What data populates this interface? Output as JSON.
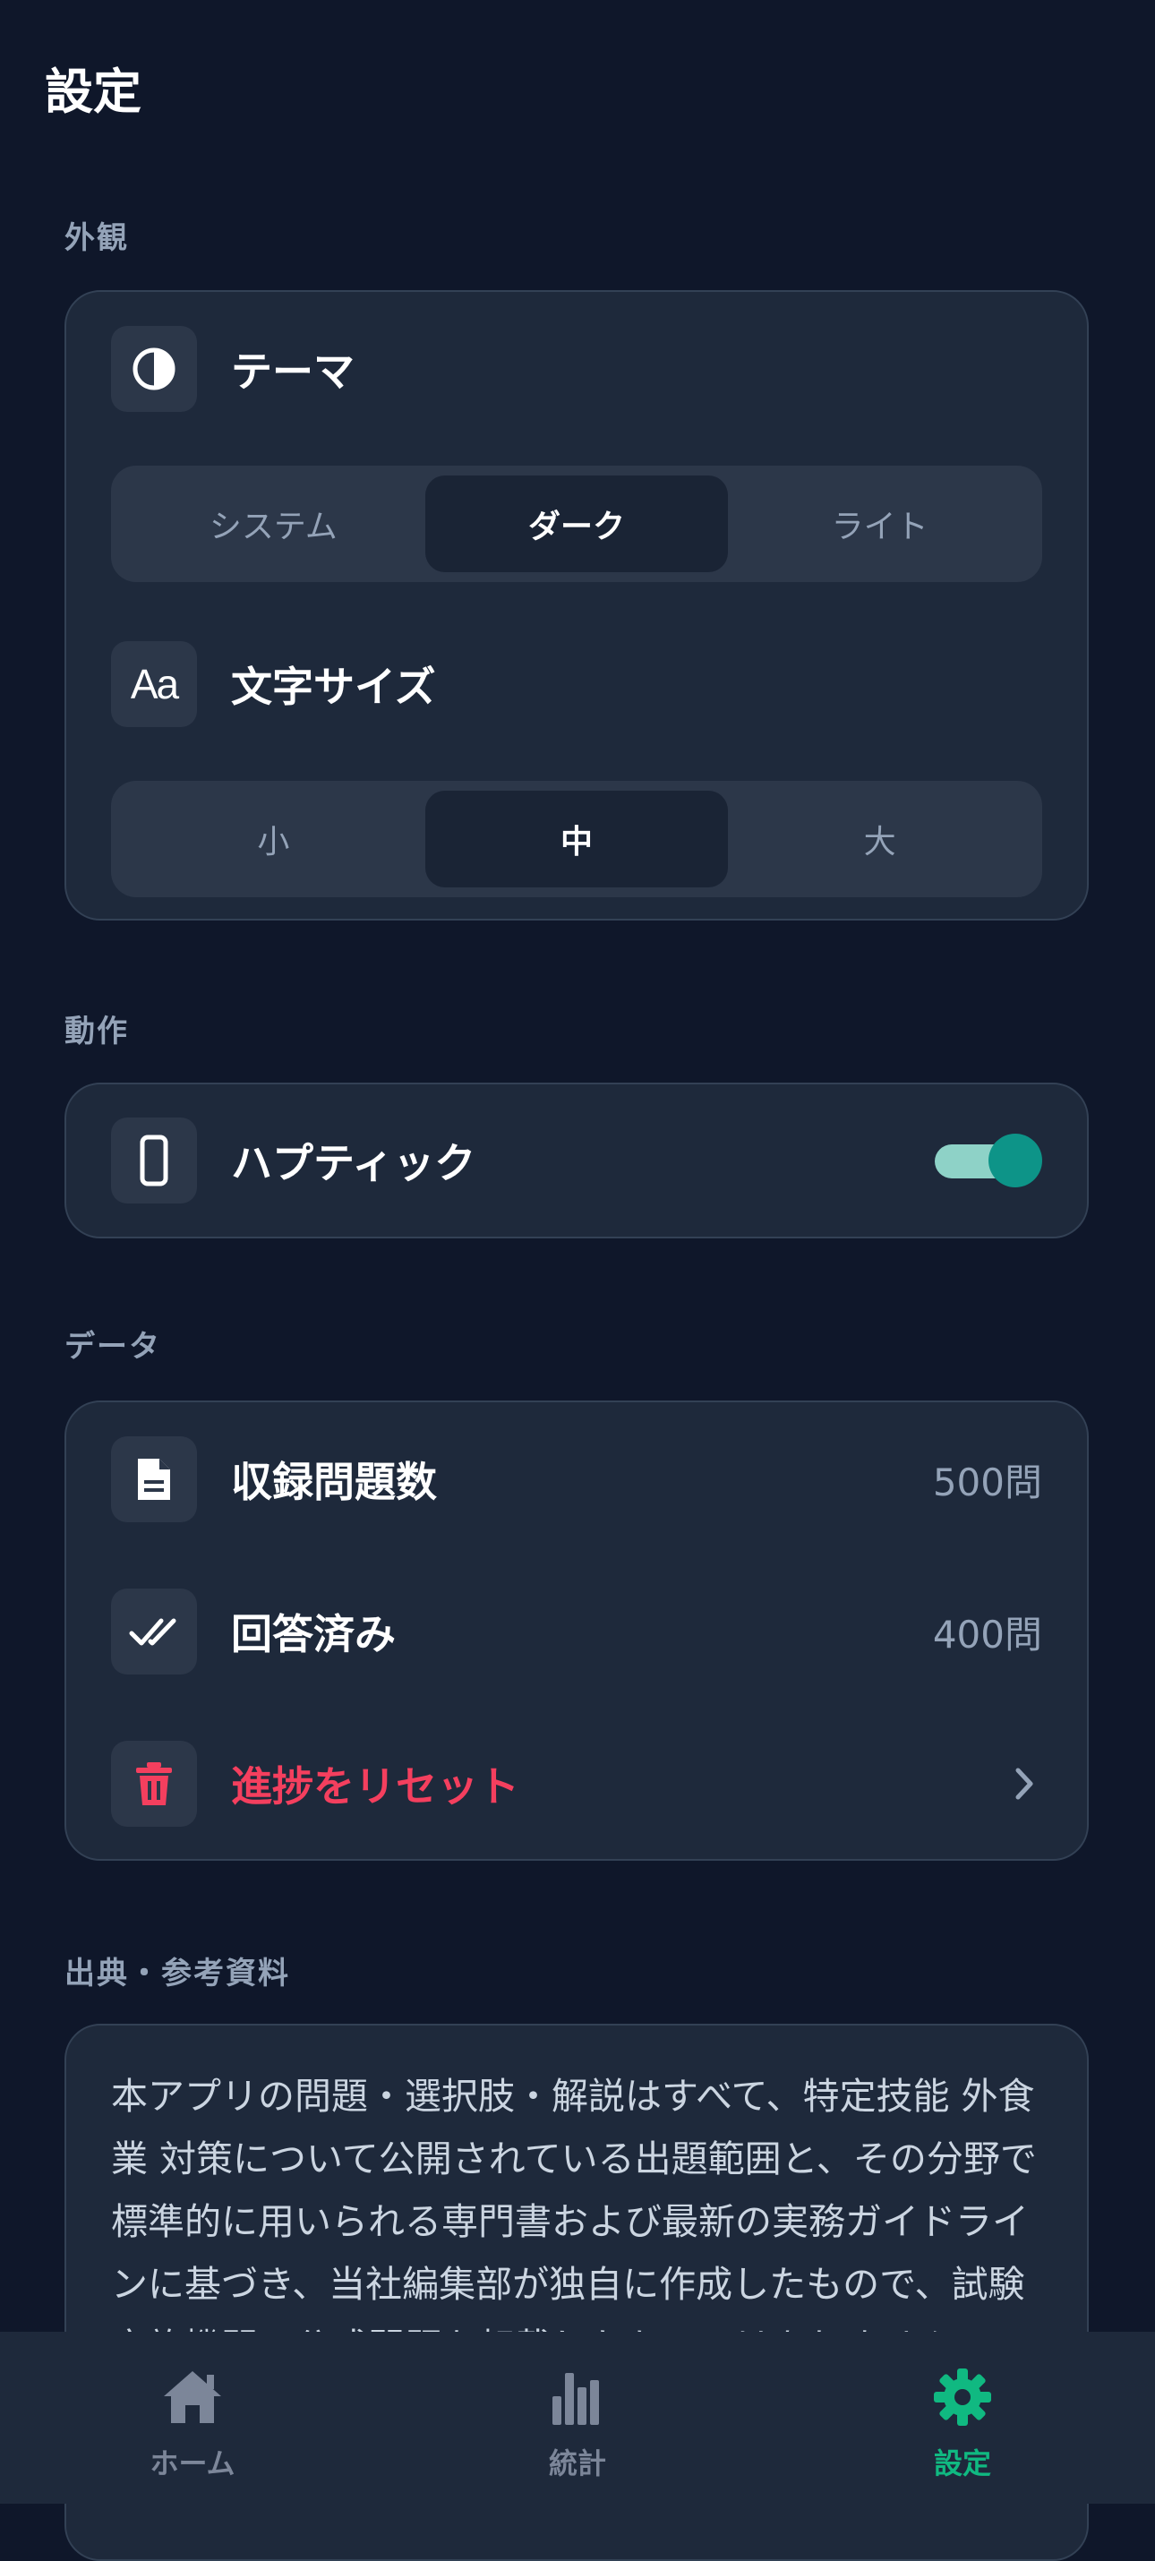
{
  "header": {
    "title": "設定"
  },
  "appearance": {
    "section_label": "外観",
    "theme": {
      "label": "テーマ",
      "icon": "contrast-icon",
      "options": [
        "システム",
        "ダーク",
        "ライト"
      ],
      "selected": "ダーク"
    },
    "font_size": {
      "label": "文字サイズ",
      "icon_text": "Aa",
      "options": [
        "小",
        "中",
        "大"
      ],
      "selected": "中"
    }
  },
  "behavior": {
    "section_label": "動作",
    "haptic": {
      "label": "ハプティック",
      "icon": "phone-icon",
      "enabled": true
    }
  },
  "data": {
    "section_label": "データ",
    "items": [
      {
        "label": "収録問題数",
        "value": "500問",
        "icon": "document-icon"
      },
      {
        "label": "回答済み",
        "value": "400問",
        "icon": "double-check-icon"
      }
    ],
    "reset": {
      "label": "進捗をリセット",
      "icon": "trash-icon"
    }
  },
  "sources": {
    "section_label": "出典・参考資料",
    "text": "本アプリの問題・選択肢・解説はすべて、特定技能 外食業 対策について公開されている出題範囲と、その分野で標準的に用いられる専門書および最新の実務ガイドラインに基づき、当社編集部が独自に作成したもので、試験実施機関の公式問題を転載したものではありません。"
  },
  "nav": {
    "items": [
      {
        "label": "ホーム",
        "icon": "home-icon"
      },
      {
        "label": "統計",
        "icon": "stats-icon"
      },
      {
        "label": "設定",
        "icon": "gear-icon"
      }
    ],
    "active": "設定"
  },
  "colors": {
    "background": "#0f172a",
    "card": "#1e293b",
    "accent": "#10b981",
    "toggle": "#0d9488",
    "danger": "#f43f5e"
  }
}
